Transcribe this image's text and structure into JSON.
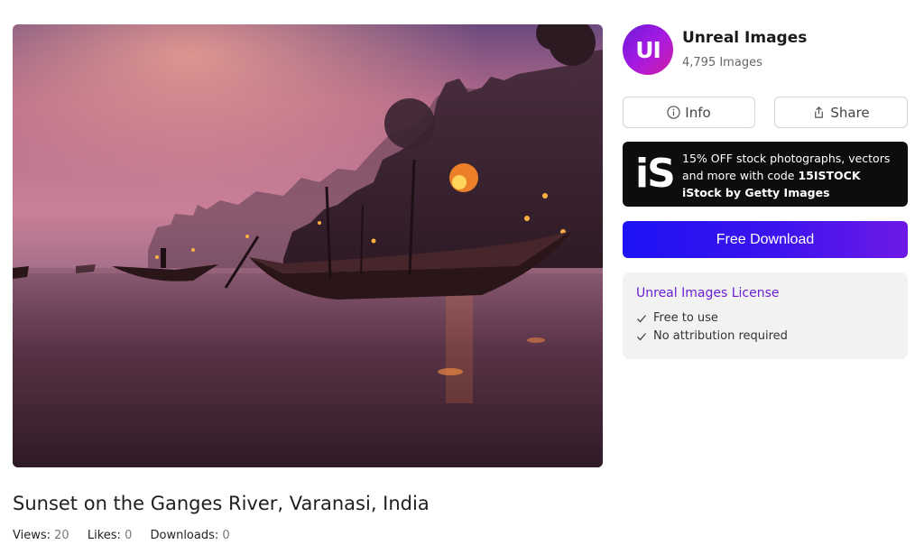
{
  "image": {
    "title": "Sunset on the Ganges River, Varanasi, India",
    "stats": [
      {
        "label": "Views:",
        "value": "20"
      },
      {
        "label": "Likes:",
        "value": "0"
      },
      {
        "label": "Downloads:",
        "value": "0"
      }
    ]
  },
  "author": {
    "avatar_text": "UI",
    "name": "Unreal Images",
    "image_count": "4,795 Images"
  },
  "actions": {
    "info_label": "Info",
    "share_label": "Share",
    "download_label": "Free Download"
  },
  "promo": {
    "logo": "iS",
    "line1": "15% OFF stock photographs, vectors",
    "line2_prefix": "and more with code ",
    "code": "15ISTOCK",
    "brand": "iStock by Getty Images"
  },
  "license": {
    "title": "Unreal Images License",
    "items": [
      "Free to use",
      "No attribution required"
    ]
  },
  "colors": {
    "download_gradient_start": "#1d12f4",
    "download_gradient_end": "#6e19e6",
    "license_title": "#6a1fd6",
    "promo_background": "#0d0d0d"
  },
  "icons": [
    "info-icon",
    "share-icon",
    "check-icon"
  ]
}
